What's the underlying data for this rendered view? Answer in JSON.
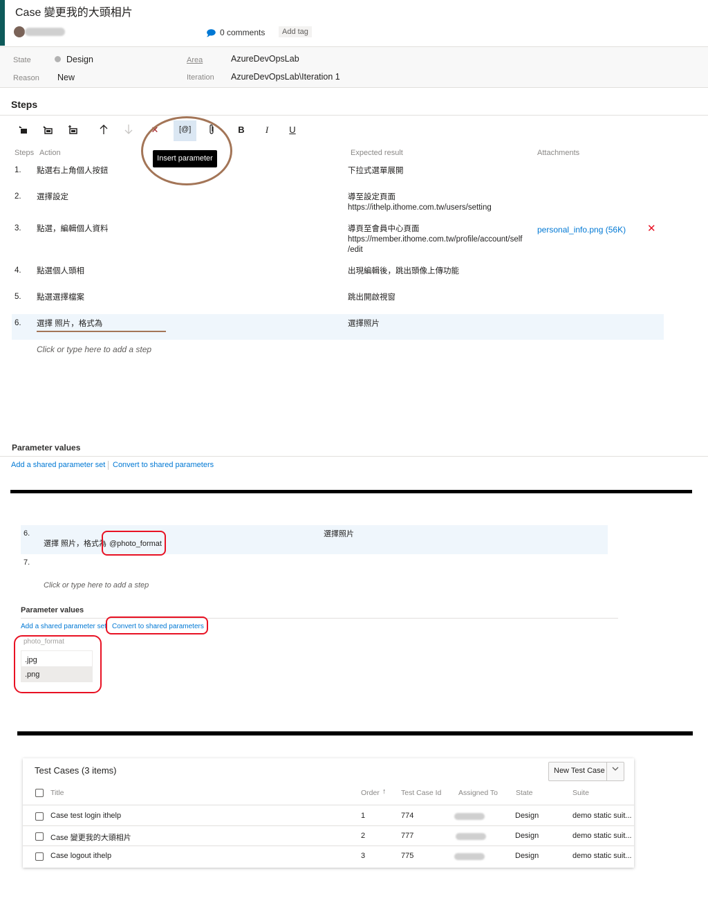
{
  "header": {
    "title": "Case 變更我的大頭相片",
    "comments": "0 comments",
    "add_tag": "Add tag"
  },
  "fields": {
    "state_label": "State",
    "state_value": "Design",
    "reason_label": "Reason",
    "reason_value": "New",
    "area_label": "Area",
    "area_value": "AzureDevOpsLab",
    "iteration_label": "Iteration",
    "iteration_value": "AzureDevOpsLab\\Iteration 1"
  },
  "steps": {
    "title": "Steps",
    "toolbar": {
      "bold": "B",
      "italic": "I",
      "underline": "U",
      "insert_param": "[@]",
      "tooltip": "Insert parameter"
    },
    "col_steps": "Steps",
    "col_action": "Action",
    "col_expected": "Expected result",
    "col_attachments": "Attachments",
    "rows": [
      {
        "num": "1.",
        "action": "點選右上角個人按鈕",
        "expected": "下拉式選單展開"
      },
      {
        "num": "2.",
        "action": "選擇設定",
        "expected": "導至設定頁面",
        "expected2": "https://ithelp.ithome.com.tw/users/setting"
      },
      {
        "num": "3.",
        "action": "點選，編輯個人資料",
        "expected": "導頁至會員中心頁面",
        "expected2": "https://member.ithome.com.tw/profile/account/self",
        "expected3": "/edit",
        "attachment": "personal_info.png (56K)"
      },
      {
        "num": "4.",
        "action": "點選個人頭相",
        "expected": "出現編輯後，跳出頭像上傳功能"
      },
      {
        "num": "5.",
        "action": "點選選擇檔案",
        "expected": "跳出開啟視窗"
      },
      {
        "num": "6.",
        "action": "選擇 照片，格式為",
        "expected": "選擇照片"
      }
    ],
    "add_step": "Click or type here to add a step"
  },
  "params": {
    "title": "Parameter values",
    "add_shared": "Add a shared parameter set",
    "convert": "Convert to shared parameters"
  },
  "zoom": {
    "row6_num": "6.",
    "row6_action": "選擇 照片，格式為",
    "param_token": "@photo_format",
    "row6_expected": "選擇照片",
    "row7_num": "7.",
    "add_step": "Click or type here to add a step",
    "params_title": "Parameter values",
    "add_shared": "Add a shared parameter set",
    "convert": "Convert to shared parameters",
    "param_name": "photo_format",
    "values": [
      ".jpg",
      ".png"
    ]
  },
  "test_cases": {
    "title": "Test Cases (3 items)",
    "new_button": "New Test Case",
    "headers": {
      "title": "Title",
      "order": "Order",
      "order_sort": "↑",
      "id": "Test Case Id",
      "assigned": "Assigned To",
      "state": "State",
      "suite": "Suite"
    },
    "rows": [
      {
        "title": "Case test login ithelp",
        "order": "1",
        "id": "774",
        "state": "Design",
        "suite": "demo static suit..."
      },
      {
        "title": "Case 變更我的大頭相片",
        "order": "2",
        "id": "777",
        "state": "Design",
        "suite": "demo static suit..."
      },
      {
        "title": "Case logout ithelp",
        "order": "3",
        "id": "775",
        "state": "Design",
        "suite": "demo static suit..."
      }
    ]
  }
}
